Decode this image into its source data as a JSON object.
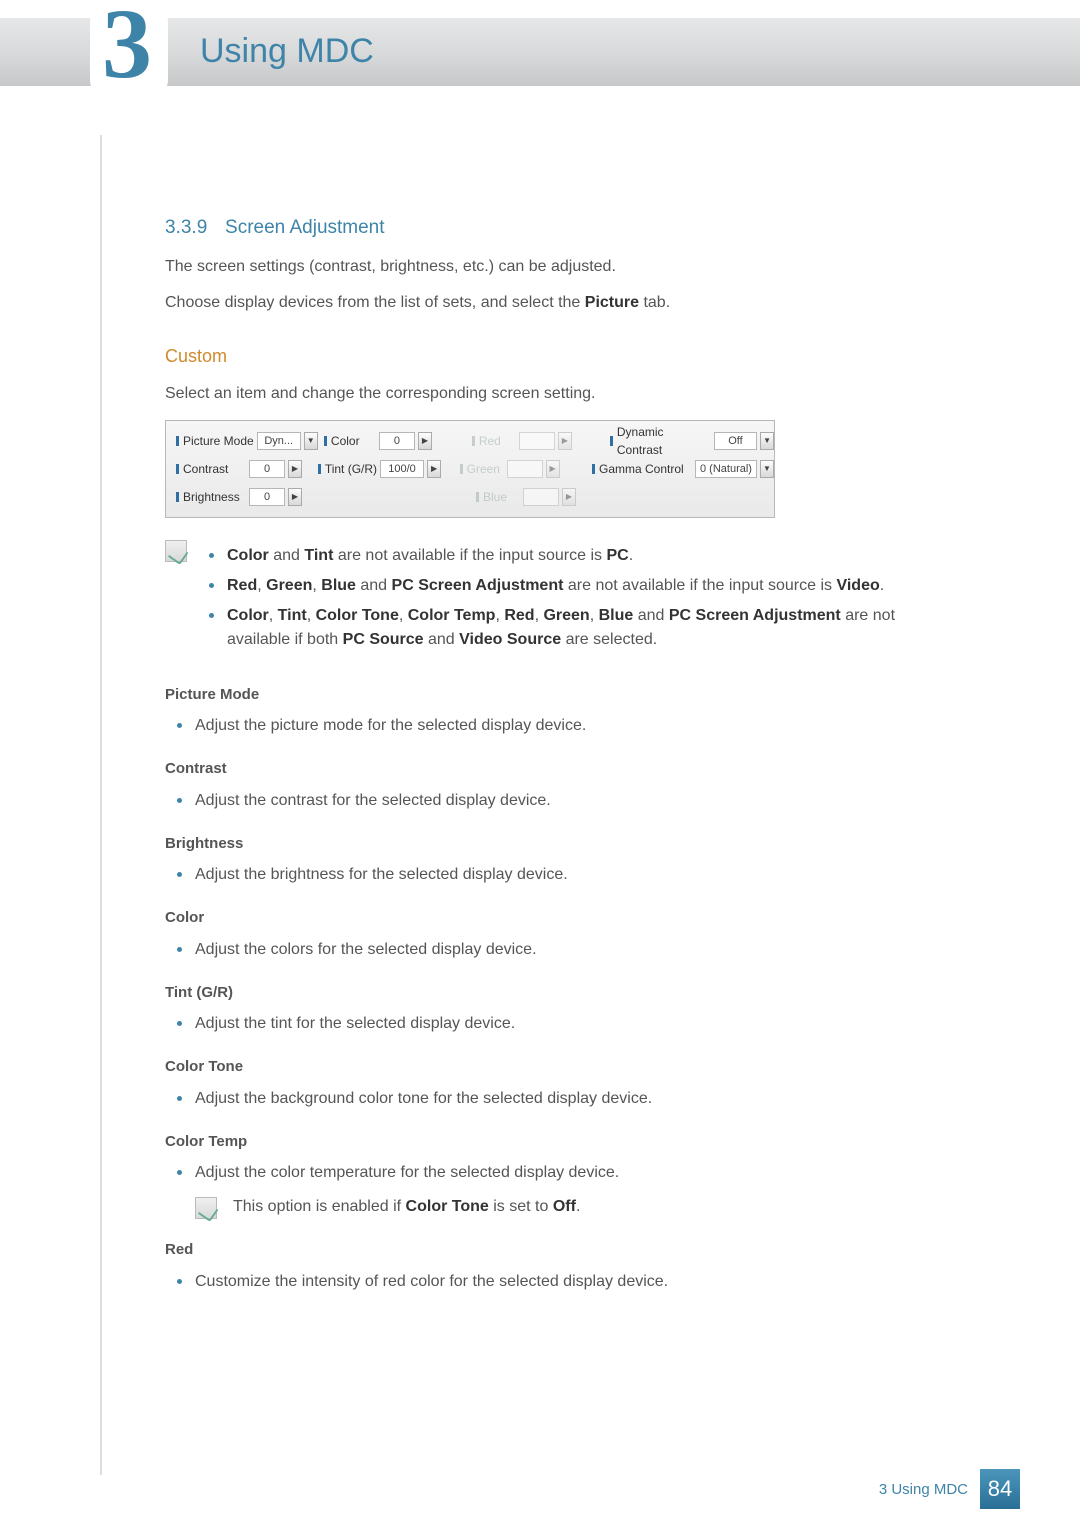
{
  "chapter": {
    "number": "3",
    "title": "Using MDC"
  },
  "section": {
    "number": "3.3.9",
    "title": "Screen Adjustment"
  },
  "intro": {
    "p1": "The screen settings (contrast, brightness, etc.) can be adjusted.",
    "p2_a": "Choose display devices from the list of sets, and select the ",
    "p2_b": "Picture",
    "p2_c": " tab."
  },
  "custom": {
    "heading": "Custom",
    "text": "Select an item and change the corresponding screen setting."
  },
  "panel": {
    "pictureMode": {
      "label": "Picture Mode",
      "value": "Dyn..."
    },
    "color": {
      "label": "Color",
      "value": "0"
    },
    "red": {
      "label": "Red"
    },
    "dynamicContrast": {
      "label": "Dynamic Contrast",
      "value": "Off"
    },
    "contrast": {
      "label": "Contrast",
      "value": "0"
    },
    "tint": {
      "label": "Tint (G/R)",
      "value": "100/0"
    },
    "green": {
      "label": "Green"
    },
    "gammaControl": {
      "label": "Gamma Control",
      "value": "0 (Natural)"
    },
    "brightness": {
      "label": "Brightness",
      "value": "0"
    },
    "blue": {
      "label": "Blue"
    }
  },
  "notes": {
    "n1": {
      "a": "Color",
      "b": " and ",
      "c": "Tint",
      "d": " are not available if the input source is ",
      "e": "PC",
      "f": "."
    },
    "n2": {
      "a": "Red",
      "b": ", ",
      "c": "Green",
      "d": ", ",
      "e": "Blue",
      "f": " and ",
      "g": "PC Screen Adjustment",
      "h": " are not available if the input source is ",
      "i": "Video",
      "j": "."
    },
    "n3": {
      "a": "Color",
      "b": ", ",
      "c": "Tint",
      "d": ", ",
      "e": "Color Tone",
      "f": ", ",
      "g": "Color Temp",
      "h": ", ",
      "i": "Red",
      "j": ", ",
      "k": "Green",
      "l": ", ",
      "m": "Blue",
      "n": " and ",
      "o": "PC Screen Adjustment",
      "p": " are not available if both ",
      "q": "PC Source",
      "r": " and ",
      "s": "Video Source",
      "t": " are selected."
    }
  },
  "defs": {
    "pictureMode": {
      "title": "Picture Mode",
      "text": "Adjust the picture mode for the selected display device."
    },
    "contrast": {
      "title": "Contrast",
      "text": "Adjust the contrast for the selected display device."
    },
    "brightness": {
      "title": "Brightness",
      "text": "Adjust the brightness for the selected display device."
    },
    "color": {
      "title": "Color",
      "text": "Adjust the colors for the selected display device."
    },
    "tint": {
      "title": "Tint (G/R)",
      "text": "Adjust the tint for the selected display device."
    },
    "colorTone": {
      "title": "Color Tone",
      "text": "Adjust the background color tone for the selected display device."
    },
    "colorTemp": {
      "title": "Color Temp",
      "text": "Adjust the color temperature for the selected display device.",
      "note": {
        "a": "This option is enabled if ",
        "b": "Color Tone",
        "c": " is set to ",
        "d": "Off",
        "e": "."
      }
    },
    "red": {
      "title": "Red",
      "text": "Customize the intensity of red color for the selected display device."
    }
  },
  "footer": {
    "label": "3 Using MDC",
    "page": "84"
  }
}
